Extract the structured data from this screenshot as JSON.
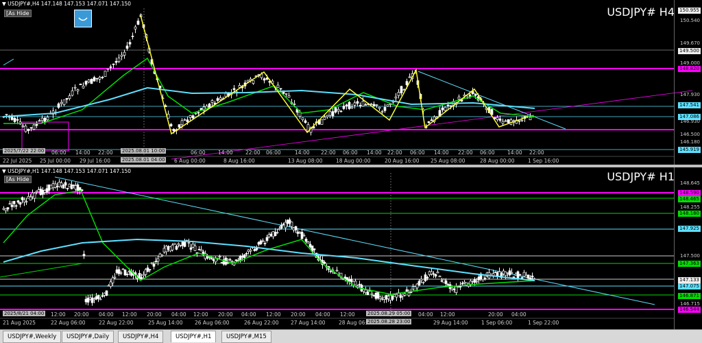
{
  "top": {
    "header": "USDJPY#,H4  147.148 147.153 147.071 147.150",
    "hide_label": "[As Hide",
    "title": "USDJPY# H4",
    "prices": [
      "150.955",
      "150.540",
      "149.670",
      "149.500",
      "149.000",
      "148.820",
      "147.930",
      "147.541",
      "147.086",
      "146.930",
      "146.500",
      "146.180",
      "145.919"
    ],
    "times": [
      "22 Jul 2025",
      "25 Jul 00:00",
      "29 Jul 16:00",
      "6 Aug 00:00",
      "8 Aug 16:00",
      "13 Aug 08:00",
      "18 Aug 00:00",
      "20 Aug 16:00",
      "25 Aug 08:00",
      "28 Aug 00:00",
      "1 Sep 16:00"
    ],
    "subtimes": [
      "06:00",
      "14:00",
      "22:00",
      "06:00",
      "14:00",
      "22:00",
      "06:00",
      "14:00",
      "22:00",
      "06:00",
      "14:00",
      "22:00",
      "06:00",
      "14:00",
      "22:00",
      "06:00",
      "14:00",
      "22:00"
    ],
    "date_tags": [
      "2025/7/22 22:00",
      "2025.08.01 10:00",
      "2025.08.01 04:00"
    ]
  },
  "bottom": {
    "header": "USDJPY#,H1  147.148 147.153 147.071 147.150",
    "hide_label": "[As Hide",
    "title": "USDJPY# H1",
    "prices": [
      "148.645",
      "148.590",
      "148.465",
      "148.255",
      "148.180",
      "147.925",
      "147.500",
      "147.363",
      "147.133",
      "147.075",
      "146.871",
      "146.715",
      "146.544"
    ],
    "times": [
      "21 Aug 2025",
      "22 Aug 06:00",
      "22 Aug 22:00",
      "25 Aug 14:00",
      "26 Aug 06:00",
      "26 Aug 22:00",
      "27 Aug 14:00",
      "28 Aug 06:00",
      "29 Aug 14:00",
      "1 Sep 06:00",
      "1 Sep 22:00"
    ],
    "subtimes": [
      "04:00",
      "12:00",
      "20:00",
      "04:00",
      "12:00",
      "20:00",
      "04:00",
      "12:00",
      "20:00",
      "04:00",
      "12:00",
      "20:00",
      "04:00",
      "12:00",
      "20:00",
      "04:00",
      "12:00",
      "20:00",
      "04:00"
    ],
    "date_tags": [
      "2025/8/21 04:00",
      "2025.08.29 05:00",
      "2025.08.28 23:00"
    ]
  },
  "tabs": [
    "USDJPY#,Weekly",
    "USDJPY#,Daily",
    "USDJPY#,H4",
    "USDJPY#,H1",
    "USDJPY#,M15"
  ],
  "colors": {
    "magenta": "#ff00ff",
    "green": "#00dd00",
    "cyan": "#5ee0ff",
    "yellow": "#ffff33",
    "candle": "#ffffff",
    "bg": "#000000"
  }
}
